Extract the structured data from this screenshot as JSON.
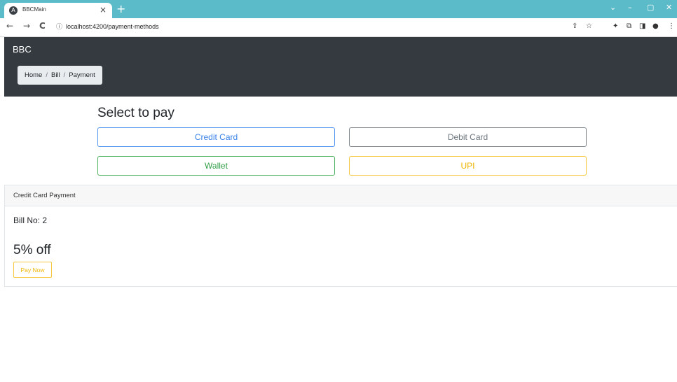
{
  "browser": {
    "tab_title": "BBCMain",
    "tab_close": "×",
    "new_tab": "+",
    "url": "localhost:4200/payment-methods",
    "window_controls": [
      "⌄",
      "–",
      "▢",
      "✕"
    ],
    "nav": {
      "back": "←",
      "forward": "→",
      "reload": "C",
      "info": "ⓘ"
    },
    "toolbar_icons": [
      "⇪",
      "☆",
      "✦",
      "⧉",
      "◨",
      "●",
      "⋮"
    ]
  },
  "navbar": {
    "brand": "BBC",
    "breadcrumb": [
      "Home",
      "Bill",
      "Payment"
    ],
    "separator": "/"
  },
  "main": {
    "heading": "Select to pay",
    "buttons": {
      "credit": "Credit Card",
      "debit": "Debit Card",
      "wallet": "Wallet",
      "upi": "UPI"
    }
  },
  "card": {
    "header": "Credit Card Payment",
    "bill_label": "Bill No: 2",
    "discount": "5% off",
    "pay_now": "Pay Now"
  },
  "colors": {
    "tabstrip": "#5bbbc9",
    "navbar": "#343a40",
    "primary": "#3a82e8",
    "secondary": "#6c757d",
    "success": "#2f9e47",
    "warning": "#f0b400"
  }
}
